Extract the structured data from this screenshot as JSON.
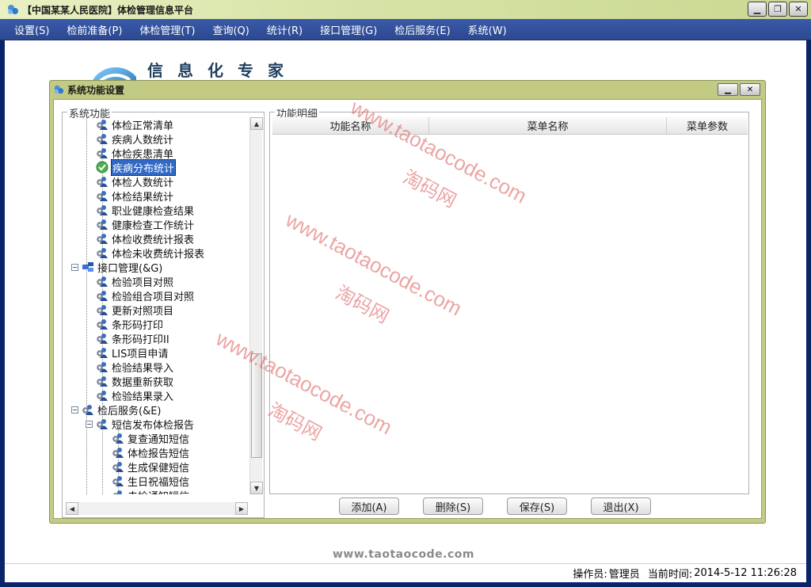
{
  "window": {
    "title": "【中国某某人民医院】体检管理信息平台",
    "controls": {
      "minimize": "▁",
      "restore": "❐",
      "close": "✕"
    }
  },
  "menubar": {
    "items": [
      "设置(S)",
      "检前准备(P)",
      "体检管理(T)",
      "查询(Q)",
      "统计(R)",
      "接口管理(G)",
      "检后服务(E)",
      "系统(W)"
    ]
  },
  "banner": {
    "text": "信息化专家"
  },
  "dialog": {
    "title": "系统功能设置",
    "left_group": "系统功能",
    "right_group": "功能明细",
    "tree": [
      {
        "label": "体检正常清单",
        "level": 2,
        "icon": "gear-person-icon"
      },
      {
        "label": "疾病人数统计",
        "level": 2,
        "icon": "gear-person-icon"
      },
      {
        "label": "体检疾患清单",
        "level": 2,
        "icon": "gear-person-icon"
      },
      {
        "label": "疾病分布统计",
        "level": 2,
        "icon": "check-icon",
        "selected": true
      },
      {
        "label": "体检人数统计",
        "level": 2,
        "icon": "gear-person-icon"
      },
      {
        "label": "体检结果统计",
        "level": 2,
        "icon": "gear-person-icon"
      },
      {
        "label": "职业健康检查结果",
        "level": 2,
        "icon": "gear-person-icon"
      },
      {
        "label": "健康检查工作统计",
        "level": 2,
        "icon": "gear-person-icon"
      },
      {
        "label": "体检收费统计报表",
        "level": 2,
        "icon": "gear-person-icon"
      },
      {
        "label": "体检未收费统计报表",
        "level": 2,
        "icon": "gear-person-icon"
      },
      {
        "label": "接口管理(&G)",
        "level": 1,
        "icon": "network-icon",
        "expander": "−"
      },
      {
        "label": "检验项目对照",
        "level": 2,
        "icon": "gear-person-icon"
      },
      {
        "label": "检验组合项目对照",
        "level": 2,
        "icon": "gear-person-icon"
      },
      {
        "label": "更新对照项目",
        "level": 2,
        "icon": "gear-person-icon"
      },
      {
        "label": "条形码打印",
        "level": 2,
        "icon": "gear-person-icon"
      },
      {
        "label": "条形码打印II",
        "level": 2,
        "icon": "gear-person-icon"
      },
      {
        "label": "LIS项目申请",
        "level": 2,
        "icon": "gear-person-icon"
      },
      {
        "label": "检验结果导入",
        "level": 2,
        "icon": "gear-person-icon"
      },
      {
        "label": "数据重新获取",
        "level": 2,
        "icon": "gear-person-icon"
      },
      {
        "label": "检验结果录入",
        "level": 2,
        "icon": "gear-person-icon"
      },
      {
        "label": "检后服务(&E)",
        "level": 1,
        "icon": "gear-person-icon",
        "expander": "−"
      },
      {
        "label": "短信发布体检报告",
        "level": 2,
        "icon": "gear-person-icon",
        "expander": "−"
      },
      {
        "label": "复查通知短信",
        "level": 3,
        "icon": "gear-person-icon"
      },
      {
        "label": "体检报告短信",
        "level": 3,
        "icon": "gear-person-icon"
      },
      {
        "label": "生成保健短信",
        "level": 3,
        "icon": "gear-person-icon"
      },
      {
        "label": "生日祝福短信",
        "level": 3,
        "icon": "gear-person-icon"
      },
      {
        "label": "未检通知短信",
        "level": 3,
        "icon": "gear-person-icon"
      }
    ],
    "table": {
      "columns": [
        "功能名称",
        "菜单名称",
        "菜单参数"
      ]
    },
    "buttons": {
      "add": "添加(A)",
      "delete": "删除(S)",
      "save": "保存(S)",
      "exit": "退出(X)"
    }
  },
  "watermarks": {
    "url": "www.taotaocode.com",
    "cn": "淘码网",
    "bottom": "www.taotaocode.com"
  },
  "statusbar": {
    "operator_label": "操作员:",
    "operator": "管理员",
    "time_label": "当前时间:",
    "time": "2014-5-12 11:26:28"
  },
  "colors": {
    "menubar": "#2c4890",
    "dialog_frame": "#c3ca83",
    "selected": "#3169c6"
  }
}
